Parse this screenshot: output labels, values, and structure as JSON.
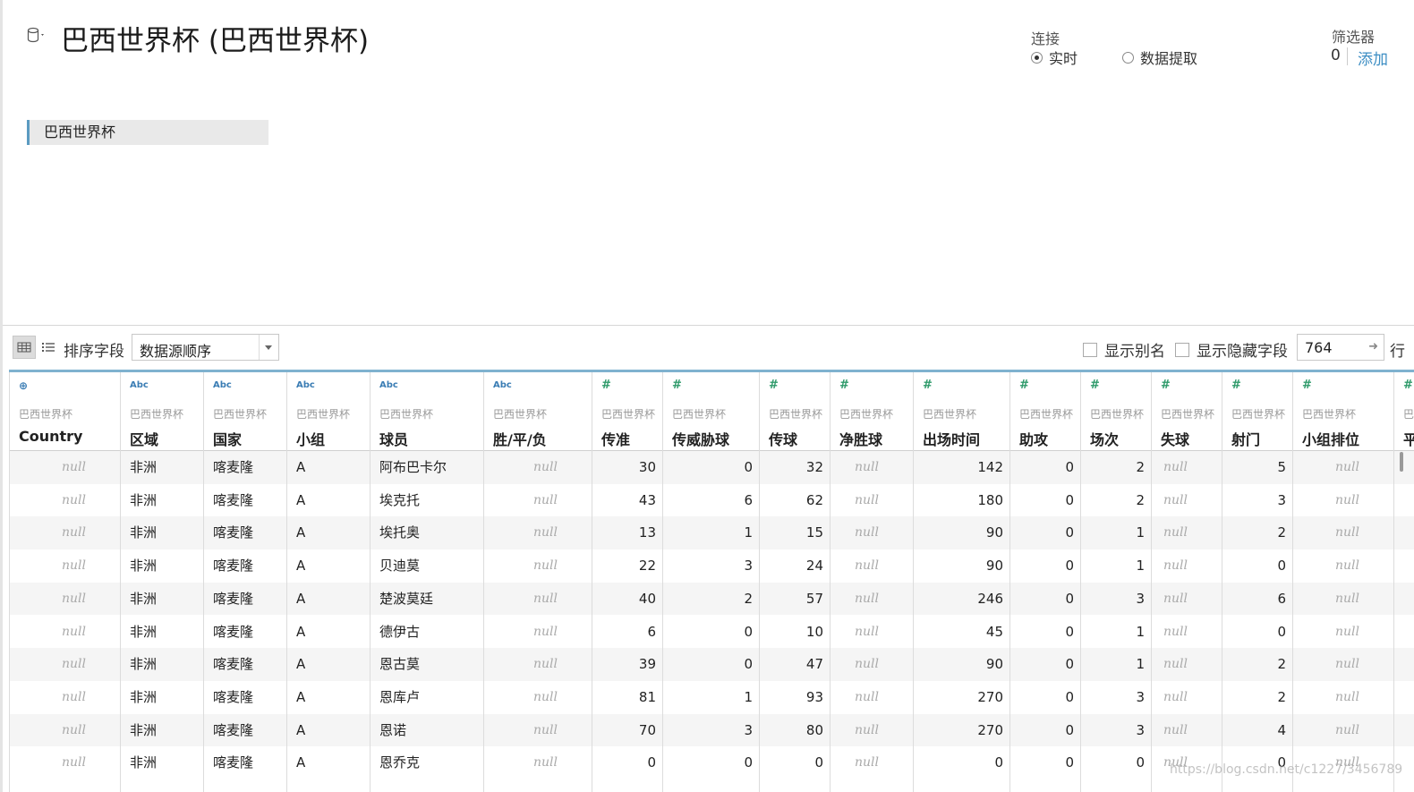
{
  "title": "巴西世界杯 (巴西世界杯)",
  "connection": {
    "label": "连接",
    "options": [
      {
        "label": "实时",
        "selected": true
      },
      {
        "label": "数据提取",
        "selected": false
      }
    ]
  },
  "filters": {
    "label": "筛选器",
    "count": "0",
    "add_label": "添加"
  },
  "tables": [
    "巴西世界杯"
  ],
  "toolbar": {
    "sort_label": "排序字段",
    "sort_value": "数据源顺序",
    "show_alias": "显示别名",
    "show_hidden": "显示隐藏字段",
    "rows_value": "764",
    "rows_suffix": "行"
  },
  "grid": {
    "source": "巴西世界杯",
    "null_text": "null",
    "columns": [
      {
        "name": "Country",
        "type": "geo"
      },
      {
        "name": "区域",
        "type": "abc"
      },
      {
        "name": "国家",
        "type": "abc"
      },
      {
        "name": "小组",
        "type": "abc"
      },
      {
        "name": "球员",
        "type": "abc"
      },
      {
        "name": "胜/平/负",
        "type": "abc"
      },
      {
        "name": "传准",
        "type": "num"
      },
      {
        "name": "传威胁球",
        "type": "num"
      },
      {
        "name": "传球",
        "type": "num"
      },
      {
        "name": "净胜球",
        "type": "num"
      },
      {
        "name": "出场时间",
        "type": "num"
      },
      {
        "name": "助攻",
        "type": "num"
      },
      {
        "name": "场次",
        "type": "num"
      },
      {
        "name": "失球",
        "type": "num"
      },
      {
        "name": "射门",
        "type": "num"
      },
      {
        "name": "小组排位",
        "type": "num"
      },
      {
        "name": "平",
        "type": "num"
      }
    ],
    "type_labels": {
      "abc": "Abc",
      "num": "#",
      "geo": "⊕"
    },
    "rows": [
      [
        null,
        "非洲",
        "喀麦隆",
        "A",
        "阿布巴卡尔",
        null,
        "30",
        "0",
        "32",
        null,
        "142",
        "0",
        "2",
        null,
        "5",
        null,
        ""
      ],
      [
        null,
        "非洲",
        "喀麦隆",
        "A",
        "埃克托",
        null,
        "43",
        "6",
        "62",
        null,
        "180",
        "0",
        "2",
        null,
        "3",
        null,
        ""
      ],
      [
        null,
        "非洲",
        "喀麦隆",
        "A",
        "埃托奥",
        null,
        "13",
        "1",
        "15",
        null,
        "90",
        "0",
        "1",
        null,
        "2",
        null,
        ""
      ],
      [
        null,
        "非洲",
        "喀麦隆",
        "A",
        "贝迪莫",
        null,
        "22",
        "3",
        "24",
        null,
        "90",
        "0",
        "1",
        null,
        "0",
        null,
        ""
      ],
      [
        null,
        "非洲",
        "喀麦隆",
        "A",
        "楚波莫廷",
        null,
        "40",
        "2",
        "57",
        null,
        "246",
        "0",
        "3",
        null,
        "6",
        null,
        ""
      ],
      [
        null,
        "非洲",
        "喀麦隆",
        "A",
        "德伊古",
        null,
        "6",
        "0",
        "10",
        null,
        "45",
        "0",
        "1",
        null,
        "0",
        null,
        ""
      ],
      [
        null,
        "非洲",
        "喀麦隆",
        "A",
        "恩古莫",
        null,
        "39",
        "0",
        "47",
        null,
        "90",
        "0",
        "1",
        null,
        "2",
        null,
        ""
      ],
      [
        null,
        "非洲",
        "喀麦隆",
        "A",
        "恩库卢",
        null,
        "81",
        "1",
        "93",
        null,
        "270",
        "0",
        "3",
        null,
        "2",
        null,
        ""
      ],
      [
        null,
        "非洲",
        "喀麦隆",
        "A",
        "恩诺",
        null,
        "70",
        "3",
        "80",
        null,
        "270",
        "0",
        "3",
        null,
        "4",
        null,
        ""
      ],
      [
        null,
        "非洲",
        "喀麦隆",
        "A",
        "恩乔克",
        null,
        "0",
        "0",
        "0",
        null,
        "0",
        "0",
        "0",
        null,
        "0",
        null,
        ""
      ]
    ]
  },
  "watermark": "https://blog.csdn.net/c1227/3456789"
}
